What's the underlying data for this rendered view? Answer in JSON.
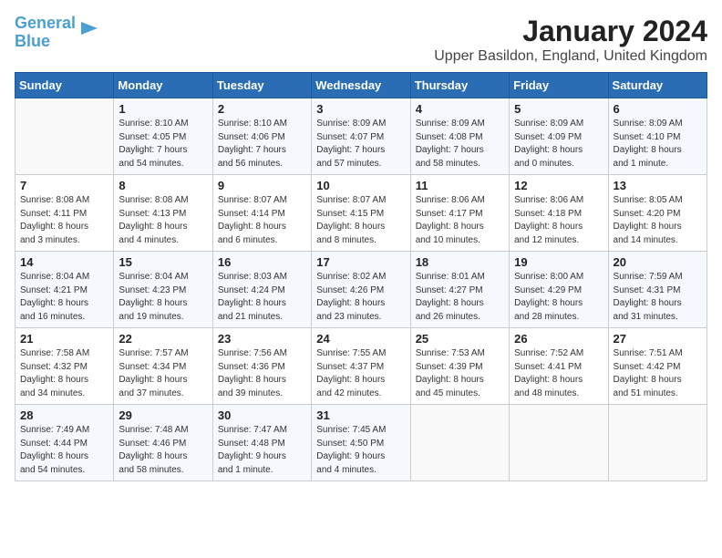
{
  "header": {
    "logo_line1": "General",
    "logo_line2": "Blue",
    "month": "January 2024",
    "location": "Upper Basildon, England, United Kingdom"
  },
  "days_of_week": [
    "Sunday",
    "Monday",
    "Tuesday",
    "Wednesday",
    "Thursday",
    "Friday",
    "Saturday"
  ],
  "weeks": [
    [
      {
        "day": "",
        "info": ""
      },
      {
        "day": "1",
        "info": "Sunrise: 8:10 AM\nSunset: 4:05 PM\nDaylight: 7 hours\nand 54 minutes."
      },
      {
        "day": "2",
        "info": "Sunrise: 8:10 AM\nSunset: 4:06 PM\nDaylight: 7 hours\nand 56 minutes."
      },
      {
        "day": "3",
        "info": "Sunrise: 8:09 AM\nSunset: 4:07 PM\nDaylight: 7 hours\nand 57 minutes."
      },
      {
        "day": "4",
        "info": "Sunrise: 8:09 AM\nSunset: 4:08 PM\nDaylight: 7 hours\nand 58 minutes."
      },
      {
        "day": "5",
        "info": "Sunrise: 8:09 AM\nSunset: 4:09 PM\nDaylight: 8 hours\nand 0 minutes."
      },
      {
        "day": "6",
        "info": "Sunrise: 8:09 AM\nSunset: 4:10 PM\nDaylight: 8 hours\nand 1 minute."
      }
    ],
    [
      {
        "day": "7",
        "info": "Sunrise: 8:08 AM\nSunset: 4:11 PM\nDaylight: 8 hours\nand 3 minutes."
      },
      {
        "day": "8",
        "info": "Sunrise: 8:08 AM\nSunset: 4:13 PM\nDaylight: 8 hours\nand 4 minutes."
      },
      {
        "day": "9",
        "info": "Sunrise: 8:07 AM\nSunset: 4:14 PM\nDaylight: 8 hours\nand 6 minutes."
      },
      {
        "day": "10",
        "info": "Sunrise: 8:07 AM\nSunset: 4:15 PM\nDaylight: 8 hours\nand 8 minutes."
      },
      {
        "day": "11",
        "info": "Sunrise: 8:06 AM\nSunset: 4:17 PM\nDaylight: 8 hours\nand 10 minutes."
      },
      {
        "day": "12",
        "info": "Sunrise: 8:06 AM\nSunset: 4:18 PM\nDaylight: 8 hours\nand 12 minutes."
      },
      {
        "day": "13",
        "info": "Sunrise: 8:05 AM\nSunset: 4:20 PM\nDaylight: 8 hours\nand 14 minutes."
      }
    ],
    [
      {
        "day": "14",
        "info": "Sunrise: 8:04 AM\nSunset: 4:21 PM\nDaylight: 8 hours\nand 16 minutes."
      },
      {
        "day": "15",
        "info": "Sunrise: 8:04 AM\nSunset: 4:23 PM\nDaylight: 8 hours\nand 19 minutes."
      },
      {
        "day": "16",
        "info": "Sunrise: 8:03 AM\nSunset: 4:24 PM\nDaylight: 8 hours\nand 21 minutes."
      },
      {
        "day": "17",
        "info": "Sunrise: 8:02 AM\nSunset: 4:26 PM\nDaylight: 8 hours\nand 23 minutes."
      },
      {
        "day": "18",
        "info": "Sunrise: 8:01 AM\nSunset: 4:27 PM\nDaylight: 8 hours\nand 26 minutes."
      },
      {
        "day": "19",
        "info": "Sunrise: 8:00 AM\nSunset: 4:29 PM\nDaylight: 8 hours\nand 28 minutes."
      },
      {
        "day": "20",
        "info": "Sunrise: 7:59 AM\nSunset: 4:31 PM\nDaylight: 8 hours\nand 31 minutes."
      }
    ],
    [
      {
        "day": "21",
        "info": "Sunrise: 7:58 AM\nSunset: 4:32 PM\nDaylight: 8 hours\nand 34 minutes."
      },
      {
        "day": "22",
        "info": "Sunrise: 7:57 AM\nSunset: 4:34 PM\nDaylight: 8 hours\nand 37 minutes."
      },
      {
        "day": "23",
        "info": "Sunrise: 7:56 AM\nSunset: 4:36 PM\nDaylight: 8 hours\nand 39 minutes."
      },
      {
        "day": "24",
        "info": "Sunrise: 7:55 AM\nSunset: 4:37 PM\nDaylight: 8 hours\nand 42 minutes."
      },
      {
        "day": "25",
        "info": "Sunrise: 7:53 AM\nSunset: 4:39 PM\nDaylight: 8 hours\nand 45 minutes."
      },
      {
        "day": "26",
        "info": "Sunrise: 7:52 AM\nSunset: 4:41 PM\nDaylight: 8 hours\nand 48 minutes."
      },
      {
        "day": "27",
        "info": "Sunrise: 7:51 AM\nSunset: 4:42 PM\nDaylight: 8 hours\nand 51 minutes."
      }
    ],
    [
      {
        "day": "28",
        "info": "Sunrise: 7:49 AM\nSunset: 4:44 PM\nDaylight: 8 hours\nand 54 minutes."
      },
      {
        "day": "29",
        "info": "Sunrise: 7:48 AM\nSunset: 4:46 PM\nDaylight: 8 hours\nand 58 minutes."
      },
      {
        "day": "30",
        "info": "Sunrise: 7:47 AM\nSunset: 4:48 PM\nDaylight: 9 hours\nand 1 minute."
      },
      {
        "day": "31",
        "info": "Sunrise: 7:45 AM\nSunset: 4:50 PM\nDaylight: 9 hours\nand 4 minutes."
      },
      {
        "day": "",
        "info": ""
      },
      {
        "day": "",
        "info": ""
      },
      {
        "day": "",
        "info": ""
      }
    ]
  ]
}
